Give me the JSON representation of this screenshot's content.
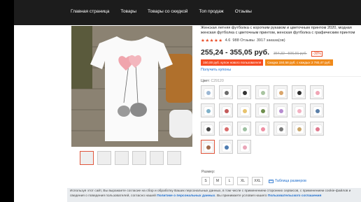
{
  "nav": [
    "Главная страница",
    "Товары",
    "Товары со скидкой",
    "Топ продаж",
    "Отзывы"
  ],
  "product": {
    "title": "Женская летняя футболка с коротким рукавом и цветочным принтом 2020, модная женская футболка с цветочным принтом, женская футболка с графическим принтом",
    "stars": "★★★★★",
    "rating": "4.6",
    "reviews": "988 Отзывы",
    "orders": "3917 заказа(ов)",
    "price": "255,24 - 355,05 руб.",
    "old_price": "364,32 - 506,91 руб.",
    "discount": "-30%",
    "coupon1": "150,00 руб. купон нового пользователя",
    "coupon2": "Скидка 150,58 руб. с каждых 2 780,47 руб.",
    "get_coupons": "Получить купоны",
    "color_label": "Цвет:",
    "color_value": "C29120",
    "size_label": "Размер:",
    "sizes": [
      "S",
      "M",
      "L",
      "XL",
      "XXL"
    ],
    "size_table": "Таблица размеров"
  },
  "swatch_colors": [
    "#9bb7d4",
    "#6b6b6b",
    "#333333",
    "#a8c4a0",
    "#d9a56b",
    "#2f2f2f",
    "#f1a5b5",
    "#7fb1c9",
    "#c35a5a",
    "#e8c36d",
    "#6f8f4e",
    "#b68bd0",
    "#f3b0c1",
    "#5a7fa8",
    "#444444",
    "#d96c6c",
    "#9ec1a2",
    "#ef8fa3",
    "#7a7a7a",
    "#c9a66b",
    "#e07a8f",
    "#a06b4c",
    "#4c7bb0",
    "#eaa6b8"
  ],
  "cookie": {
    "text1": "Используя этот сайт, Вы выражаете согласие на сбор и обработку Ваших персональных данных, в том числе с применением сторонних сервисов, с применением cookie-файлов и сведения о",
    "text2": "поведения пользователей, согласно нашей",
    "link1": "Политике о персональных данных",
    "text3": ". Вы принимаете условия нашего",
    "link2": "Пользовательского соглашения"
  }
}
